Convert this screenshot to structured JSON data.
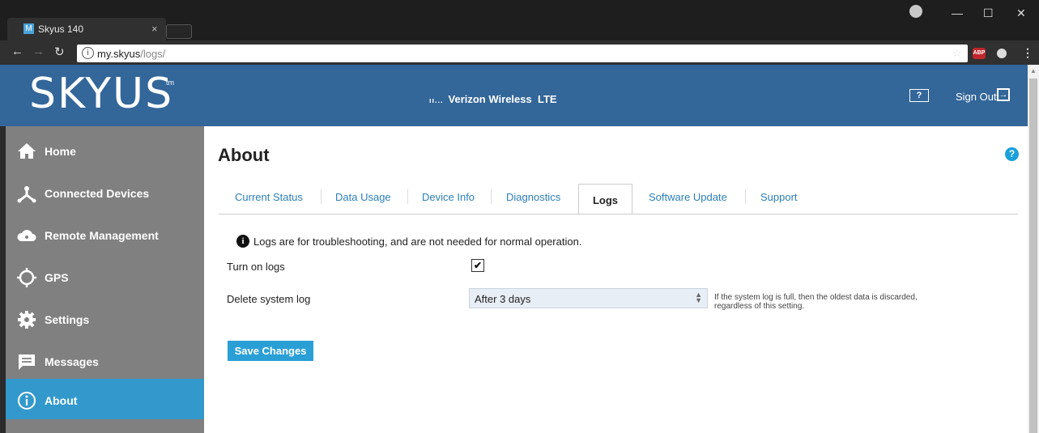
{
  "browser": {
    "tab_title": "Skyus 140",
    "tab_favicon": "M",
    "tab_close": "×",
    "url_host": "my.skyus",
    "url_path": "/logs/",
    "info_icon": "i",
    "abp_label": "ABP"
  },
  "header": {
    "logo": "SKYUS",
    "logo_tm": "tm",
    "carrier_bars": "ıı...",
    "carrier": "Verizon Wireless",
    "network": "LTE",
    "help_label": "?",
    "sign_out": "Sign Out"
  },
  "sidebar": {
    "items": [
      {
        "label": "Home",
        "icon": "home-icon"
      },
      {
        "label": "Connected Devices",
        "icon": "connected-devices-icon"
      },
      {
        "label": "Remote Management",
        "icon": "cloud-icon"
      },
      {
        "label": "GPS",
        "icon": "gps-icon"
      },
      {
        "label": "Settings",
        "icon": "gear-icon"
      },
      {
        "label": "Messages",
        "icon": "message-icon"
      },
      {
        "label": "About",
        "icon": "info-circle-icon",
        "active": true
      }
    ]
  },
  "main": {
    "title": "About",
    "help_icon": "?",
    "tabs": [
      {
        "label": "Current Status"
      },
      {
        "label": "Data Usage"
      },
      {
        "label": "Device Info"
      },
      {
        "label": "Diagnostics"
      },
      {
        "label": "Logs",
        "active": true
      },
      {
        "label": "Software Update"
      },
      {
        "label": "Support"
      }
    ],
    "info_glyph": "i",
    "info_text": "Logs are for troubleshooting, and are not needed for normal operation.",
    "turn_on_logs_label": "Turn on logs",
    "turn_on_logs_checked": true,
    "checkmark": "✔",
    "delete_log_label": "Delete system log",
    "delete_log_value": "After 3 days",
    "delete_log_note_line1": "If the system log is full, then the oldest data is discarded,",
    "delete_log_note_line2": "regardless of this setting.",
    "save_button": "Save Changes"
  },
  "colors": {
    "header_bg": "#336699",
    "sidebar_bg": "#808080",
    "sidebar_active": "#3399cc",
    "link": "#2c7fb8",
    "button": "#2a9fd6"
  }
}
